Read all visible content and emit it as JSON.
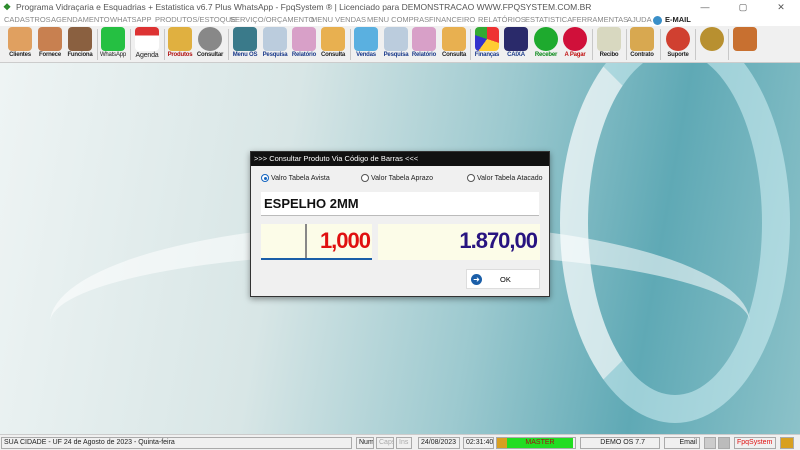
{
  "window": {
    "title": "Programa Vidraçaria e Esquadrias + Estatistica v6.7 Plus WhatsApp - FpqSystem ® | Licenciado para  DEMONSTRACAO WWW.FPQSYSTEM.COM.BR",
    "min": "—",
    "max": "▢",
    "close": "✕"
  },
  "menu": [
    "CADASTROS",
    "AGENDAMENTO",
    "WHATSAPP",
    "PRODUTOS/ESTOQUE",
    "SERVIÇO/ORÇAMENTO",
    "MENU VENDAS",
    "MENU COMPRAS",
    "FINANCEIRO",
    "RELATÓRIOS",
    "ESTATISTICA",
    "FERRAMENTAS",
    "AJUDA",
    "E-MAIL"
  ],
  "toolbar": [
    "Clientes",
    "Fornece",
    "Funciona",
    "WhatsApp",
    "Agenda",
    "Produtos",
    "Consultar",
    "Menu OS",
    "Pesquisa",
    "Relatório",
    "Consulta",
    "Vendas",
    "Pesquisa",
    "Relatório",
    "Consulta",
    "Finanças",
    "CAIXA",
    "Receber",
    "A Pagar",
    "Recibo",
    "Contrato",
    "Suporte"
  ],
  "dialog": {
    "title": ">>> Consultar Produto Via Código de Barras <<<",
    "radio1": "Valro Tabela Avista",
    "radio2": "Valor Tabela Aprazo",
    "radio3": "Valor Tabela Atacado",
    "selected": "Valro Tabela Avista",
    "product": "ESPELHO 2MM",
    "quantity": "1,000",
    "price": "1.870,00",
    "ok": "OK"
  },
  "status": {
    "city": "SUA CIDADE - UF 24 de Agosto de 2023 - Quinta-feira",
    "num": "Num",
    "caps": "Caps",
    "ins": "Ins",
    "date": "24/08/2023",
    "time": "02:31:40",
    "user": "MASTER",
    "version": "DEMO OS 7.7",
    "email": "Email",
    "brand": "FpqSystem"
  }
}
